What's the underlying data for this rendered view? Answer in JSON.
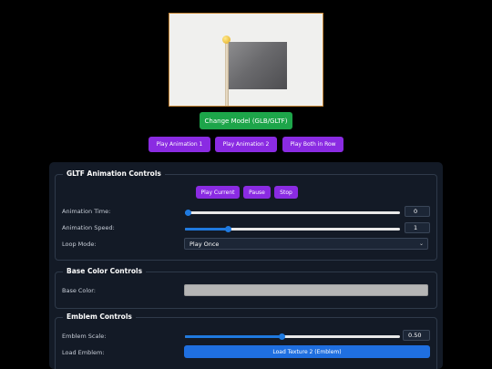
{
  "viewer": {
    "model": "flag-model"
  },
  "top_buttons": {
    "change_model": "Change Model (GLB/GLTF)",
    "play_anim_1": "Play Animation 1",
    "play_anim_2": "Play Animation 2",
    "play_both": "Play Both in Row"
  },
  "gltf": {
    "title": "GLTF Animation Controls",
    "play_current": "Play Current",
    "pause": "Pause",
    "stop": "Stop",
    "time_label": "Animation Time:",
    "time_value": "0",
    "time_fraction": 0.0,
    "speed_label": "Animation Speed:",
    "speed_value": "1",
    "speed_fraction": 0.19,
    "loop_label": "Loop Mode:",
    "loop_value": "Play Once"
  },
  "base_color": {
    "title": "Base Color Controls",
    "label": "Base Color:",
    "color": "#b5b5b5"
  },
  "emblem": {
    "title": "Emblem Controls",
    "scale_label": "Emblem Scale:",
    "scale_value": "0.50",
    "scale_fraction": 0.45,
    "load_label": "Load Emblem:",
    "load_button": "Load Texture 2 (Emblem)"
  },
  "colors": {
    "green": "#1da54a",
    "purple": "#8a2be2",
    "blue": "#1f6fe0",
    "panel_bg": "#131a26"
  }
}
